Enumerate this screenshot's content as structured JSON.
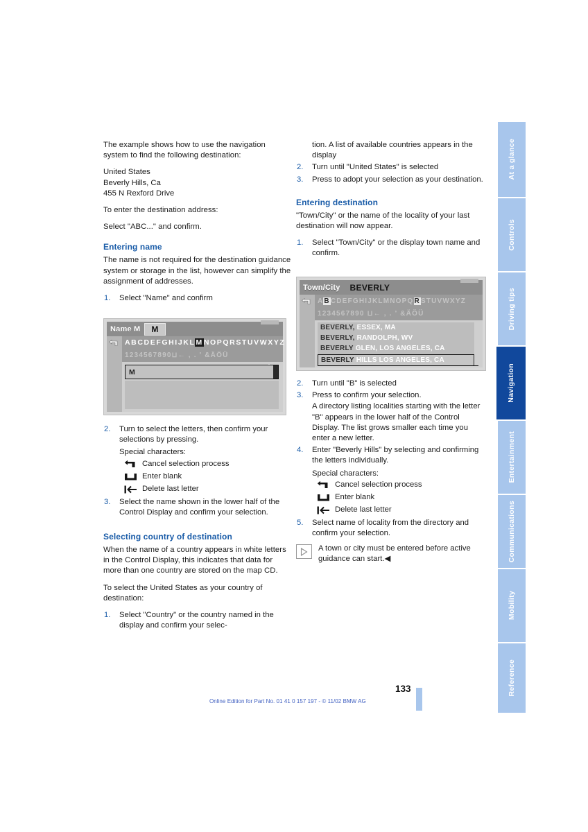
{
  "page": {
    "number": "133",
    "footer_note": "Online Edition for Part No. 01 41 0 157 197 - © 11/02 BMW AG"
  },
  "rail": {
    "tabs": [
      {
        "label": "At a glance",
        "active": false
      },
      {
        "label": "Controls",
        "active": false
      },
      {
        "label": "Driving tips",
        "active": false
      },
      {
        "label": "Navigation",
        "active": true
      },
      {
        "label": "Entertainment",
        "active": false
      },
      {
        "label": "Communications",
        "active": false
      },
      {
        "label": "Mobility",
        "active": false
      },
      {
        "label": "Reference",
        "active": false
      }
    ]
  },
  "left_column": {
    "intro": "The example shows how to use the navigation system to find the following destination:",
    "address": {
      "line1": "United States",
      "line2": "Beverly Hills, Ca",
      "line3": "455 N Rexford Drive"
    },
    "to_enter": "To enter the destination address:",
    "select_abc": "Select \"ABC...\" and confirm.",
    "entering_name": {
      "heading": "Entering name",
      "body": "The name is not required for the destination guidance system or storage in the list, however can simplify the assignment of addresses.",
      "step1_num": "1.",
      "step1_text": "Select \"Name\" and confirm",
      "step2_num": "2.",
      "step2_text": "Turn to select the letters, then confirm your selections by pressing.",
      "special_label": "Special characters:",
      "special_chars": [
        {
          "icon": "cancel-arrow-icon",
          "label": "Cancel selection process"
        },
        {
          "icon": "blank-space-icon",
          "label": "Enter blank"
        },
        {
          "icon": "delete-letter-icon",
          "label": "Delete last letter"
        }
      ],
      "step3_num": "3.",
      "step3_text": "Select the name shown in the lower half of the Control Display and confirm your selection."
    },
    "selecting_country": {
      "heading": "Selecting country of destination",
      "body1": "When the name of a country appears in white letters in the Control Display, this indicates that data for more than one country are stored on the map CD.",
      "body2": "To select the United States as your country of destination:",
      "step1_num": "1.",
      "step1_text": "Select \"Country\" or the country named in the display and confirm your selec-"
    },
    "screenshot": {
      "title_label": "Name M",
      "title_value": "M",
      "alpha_before": "ABCDEFGHIJKL",
      "alpha_highlight": "M",
      "alpha_after": "NOPQRSTUVWXYZ",
      "numbers_row": "1234567890⊔← , . ' &ÄÖÜ",
      "input_value": "M",
      "back_icon": "back-arrow-icon",
      "delete_icon": "delete-letter-icon"
    }
  },
  "right_column": {
    "country_cont": {
      "cont_text": "tion. A list of available countries appears in the display",
      "step2_num": "2.",
      "step2_text": "Turn until \"United States\" is selected",
      "step3_num": "3.",
      "step3_text": "Press to adopt your selection as your destination."
    },
    "entering_destination": {
      "heading": "Entering destination",
      "body": "\"Town/City\" or the name of the locality of your last destination will now appear.",
      "step1_num": "1.",
      "step1_text": "Select \"Town/City\" or the display town name and confirm.",
      "step2_num": "2.",
      "step2_text": "Turn until \"B\" is selected",
      "step3_num": "3.",
      "step3_text": "Press to confirm your selection.",
      "step3_sub": "A directory listing localities starting with the letter \"B\" appears in the lower half of the Control Display. The list grows smaller each time you enter a new letter.",
      "step4_num": "4.",
      "step4_text": "Enter \"Beverly Hills\" by selecting and confirming the letters individually.",
      "special_label": "Special characters:",
      "special_chars": [
        {
          "icon": "cancel-arrow-icon",
          "label": "Cancel selection process"
        },
        {
          "icon": "blank-space-icon",
          "label": "Enter blank"
        },
        {
          "icon": "delete-letter-icon",
          "label": "Delete last letter"
        }
      ],
      "step5_num": "5.",
      "step5_text": "Select name of locality from the directory and confirm your selection.",
      "note_icon": "triangle-note-icon",
      "note_text": "A town or city must be entered before active guidance can start.◀"
    },
    "screenshot": {
      "title_label": "Town/City",
      "title_value": "BEVERLY",
      "alpha_before": "A",
      "alpha_highlight": "B",
      "alpha_after": "CDEFGHIJKLMNOPQ",
      "alpha_highlight2": "R",
      "alpha_after2": "STUVWXYZ",
      "numbers_row": "1234567890 ⊔← , . ' &ÄÖÜ",
      "back_icon": "back-arrow-icon",
      "delete_icon": "delete-letter-icon",
      "results": [
        {
          "bold": "BEVERLY,",
          "rest": "ESSEX, MA",
          "selected": false
        },
        {
          "bold": "BEVERLY,",
          "rest": "RANDOLPH, WV",
          "selected": false
        },
        {
          "bold": "BEVERLY",
          "rest": "GLEN, LOS ANGELES, CA",
          "selected": false
        },
        {
          "bold": "BEVERLY",
          "rest": "HILLS LOS ANGELES, CA",
          "selected": true
        }
      ]
    }
  }
}
